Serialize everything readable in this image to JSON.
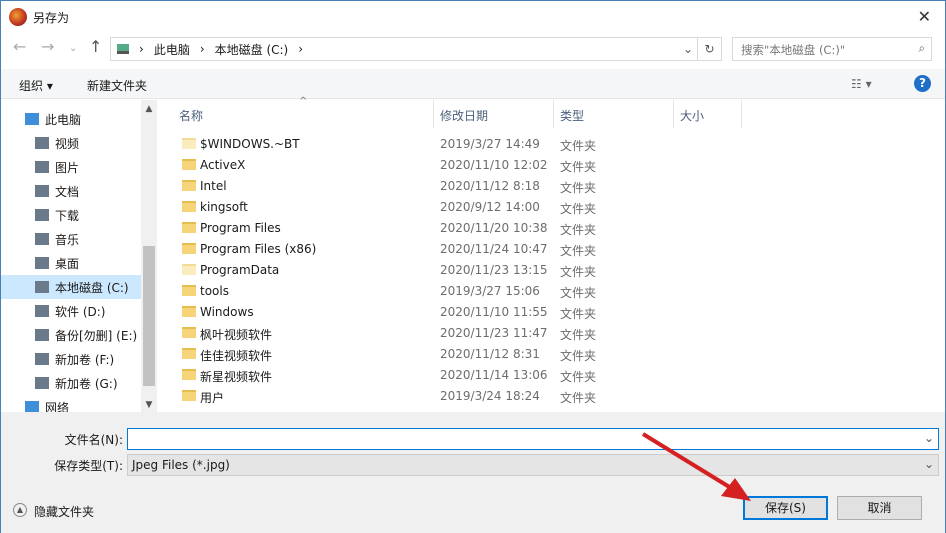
{
  "title": "另存为",
  "breadcrumb": [
    "此电脑",
    "本地磁盘 (C:)"
  ],
  "search_placeholder": "搜索\"本地磁盘 (C:)\"",
  "toolbar": {
    "organize": "组织 ▾",
    "new_folder": "新建文件夹",
    "help": "?"
  },
  "sidebar": [
    {
      "label": "此电脑",
      "top": true
    },
    {
      "label": "视频"
    },
    {
      "label": "图片"
    },
    {
      "label": "文档"
    },
    {
      "label": "下载"
    },
    {
      "label": "音乐"
    },
    {
      "label": "桌面"
    },
    {
      "label": "本地磁盘 (C:)",
      "selected": true
    },
    {
      "label": "软件 (D:)"
    },
    {
      "label": "备份[勿删] (E:)"
    },
    {
      "label": "新加卷 (F:)"
    },
    {
      "label": "新加卷 (G:)"
    },
    {
      "label": "网络",
      "top": true
    }
  ],
  "columns": {
    "name": "名称",
    "date": "修改日期",
    "type": "类型",
    "size": "大小"
  },
  "files": [
    {
      "name": "$WINDOWS.~BT",
      "date": "2019/3/27 14:49",
      "type": "文件夹",
      "pale": true
    },
    {
      "name": "ActiveX",
      "date": "2020/11/10 12:02",
      "type": "文件夹"
    },
    {
      "name": "Intel",
      "date": "2020/11/12 8:18",
      "type": "文件夹"
    },
    {
      "name": "kingsoft",
      "date": "2020/9/12 14:00",
      "type": "文件夹"
    },
    {
      "name": "Program Files",
      "date": "2020/11/20 10:38",
      "type": "文件夹"
    },
    {
      "name": "Program Files (x86)",
      "date": "2020/11/24 10:47",
      "type": "文件夹"
    },
    {
      "name": "ProgramData",
      "date": "2020/11/23 13:15",
      "type": "文件夹",
      "pale": true
    },
    {
      "name": "tools",
      "date": "2019/3/27 15:06",
      "type": "文件夹"
    },
    {
      "name": "Windows",
      "date": "2020/11/10 11:55",
      "type": "文件夹"
    },
    {
      "name": "枫叶视频软件",
      "date": "2020/11/23 11:47",
      "type": "文件夹"
    },
    {
      "name": "佳佳视频软件",
      "date": "2020/11/12 8:31",
      "type": "文件夹"
    },
    {
      "name": "新星视频软件",
      "date": "2020/11/14 13:06",
      "type": "文件夹"
    },
    {
      "name": "用户",
      "date": "2019/3/24 18:24",
      "type": "文件夹"
    }
  ],
  "filename_label": "文件名(N):",
  "filename_value": "",
  "filetype_label": "保存类型(T):",
  "filetype_value": "Jpeg Files (*.jpg)",
  "hide_folders": "隐藏文件夹",
  "save": "保存(S)",
  "cancel": "取消"
}
